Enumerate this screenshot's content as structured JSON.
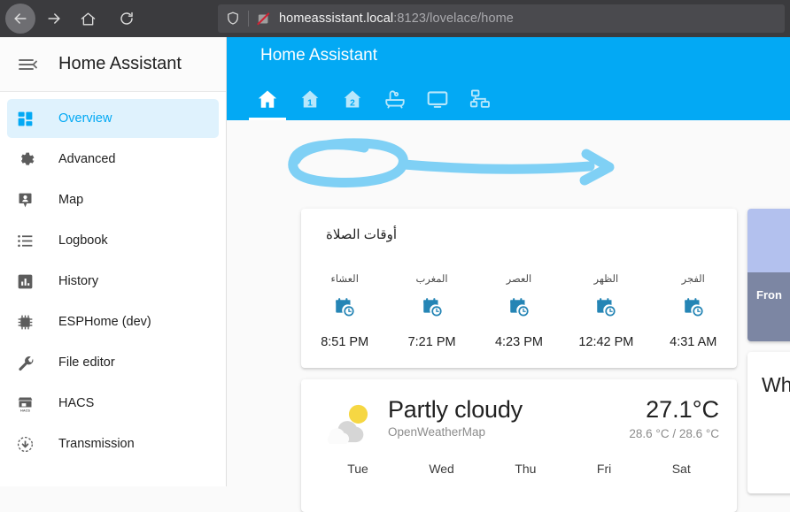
{
  "browser": {
    "back_icon": "arrow-left-icon",
    "forward_icon": "arrow-right-icon",
    "home_icon": "home-icon",
    "reload_icon": "reload-icon",
    "shield_icon": "shield-icon",
    "noscript_icon": "noscript-slash-icon",
    "url_host": "homeassistant.local",
    "url_rest": ":8123/lovelace/home"
  },
  "sidebar": {
    "menu_icon": "menu-open-icon",
    "title": "Home Assistant",
    "items": [
      {
        "label": "Overview",
        "icon": "view-dashboard-icon",
        "active": true
      },
      {
        "label": "Advanced",
        "icon": "gear-icon",
        "active": false
      },
      {
        "label": "Map",
        "icon": "map-marker-account-icon",
        "active": false
      },
      {
        "label": "Logbook",
        "icon": "format-list-bulleted-icon",
        "active": false
      },
      {
        "label": "History",
        "icon": "chart-box-icon",
        "active": false
      },
      {
        "label": "ESPHome (dev)",
        "icon": "chip-icon",
        "active": false
      },
      {
        "label": "File editor",
        "icon": "wrench-icon",
        "active": false
      },
      {
        "label": "HACS",
        "icon": "hacs-storefront-icon",
        "active": false
      },
      {
        "label": "Transmission",
        "icon": "download-circle-icon",
        "active": false
      }
    ]
  },
  "header": {
    "title": "Home Assistant",
    "accent_color": "#03a9f4",
    "tabs": [
      {
        "icon": "home-icon",
        "active": true
      },
      {
        "icon": "home-floor-1-icon",
        "active": false
      },
      {
        "icon": "home-floor-2-icon",
        "active": false
      },
      {
        "icon": "bathtub-icon",
        "active": false
      },
      {
        "icon": "television-icon",
        "active": false
      },
      {
        "icon": "sitemap-icon",
        "active": false
      }
    ]
  },
  "prayer_card": {
    "title": "أوقات الصلاة",
    "icon": "calendar-clock-icon",
    "icon_color": "#2585b5",
    "entries": [
      {
        "name": "الفجر",
        "time": "4:31 AM"
      },
      {
        "name": "الظهر",
        "time": "12:42 PM"
      },
      {
        "name": "العصر",
        "time": "4:23 PM"
      },
      {
        "name": "المغرب",
        "time": "7:21 PM"
      },
      {
        "name": "العشاء",
        "time": "8:51 PM"
      }
    ]
  },
  "weather_card": {
    "icon": "partly-cloudy-icon",
    "condition": "Partly cloudy",
    "source": "OpenWeatherMap",
    "temperature": "27.1°C",
    "temperature_range": "28.6 °C / 28.6 °C",
    "forecast_days": [
      "Tue",
      "Wed",
      "Thu",
      "Fri",
      "Sat"
    ]
  },
  "camera_card": {
    "caption": "Fron",
    "image_color": "#b3c1ee",
    "caption_bg": "#7c86a3"
  },
  "info_card": {
    "title": "Wh"
  },
  "annotation": {
    "color": "#7fd0f5",
    "shape": "hand-drawn-ellipse-with-arrow"
  }
}
